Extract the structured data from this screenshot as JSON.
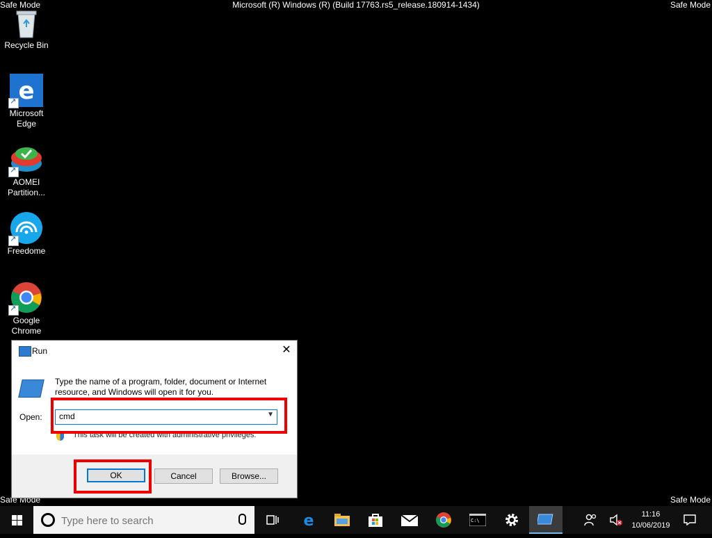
{
  "desktop": {
    "safe_mode": "Safe Mode",
    "build": "Microsoft (R) Windows (R) (Build 17763.rs5_release.180914-1434)",
    "icons": [
      {
        "label": "Recycle Bin"
      },
      {
        "label": "Microsoft Edge"
      },
      {
        "label": "AOMEI Partition..."
      },
      {
        "label": "Freedome"
      },
      {
        "label": "Google Chrome"
      }
    ]
  },
  "run_dialog": {
    "title": "Run",
    "close": "✕",
    "description": "Type the name of a program, folder, document or Internet resource, and Windows will open it for you.",
    "open_label": "Open:",
    "open_value": "cmd",
    "admin_note": "This task will be created with administrative privileges.",
    "ok": "OK",
    "cancel": "Cancel",
    "browse": "Browse..."
  },
  "taskbar": {
    "search_placeholder": "Type here to search",
    "time": "11:16",
    "date": "10/06/2019"
  },
  "colors": {
    "taskbar": "#101010",
    "accent": "#0078d7",
    "highlight": "#e00000"
  }
}
